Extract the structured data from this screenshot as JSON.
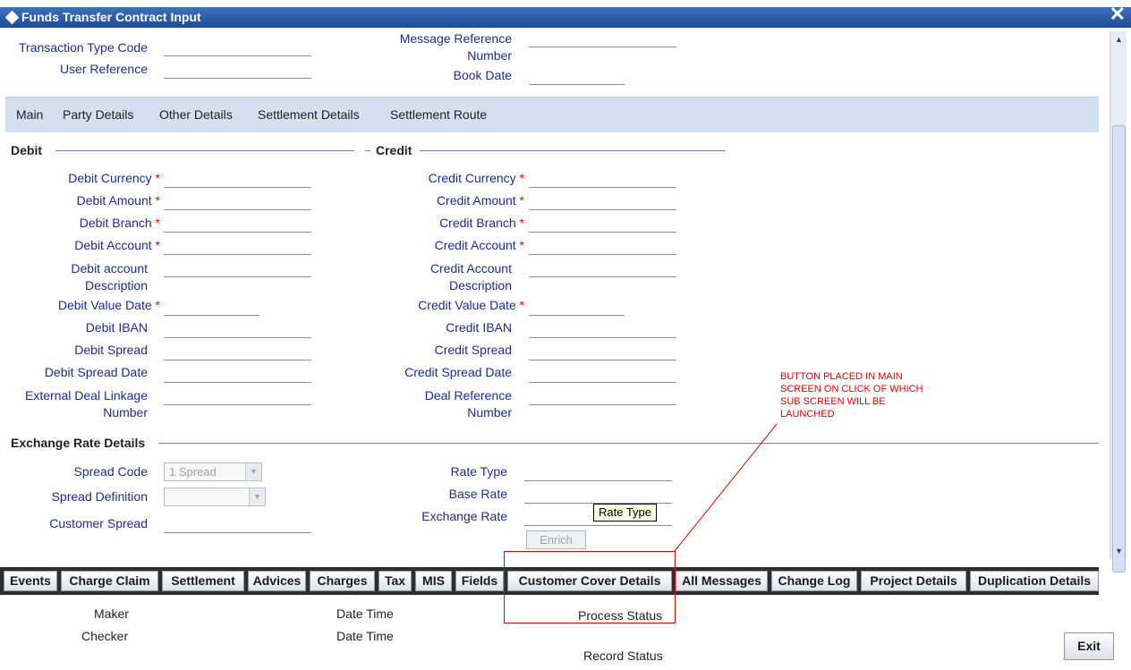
{
  "window": {
    "title": "Funds Transfer Contract Input",
    "close": "✕"
  },
  "header": {
    "transaction_type_code": "Transaction Type Code",
    "user_reference": "User Reference",
    "message_reference_1": "Message Reference",
    "message_reference_2": "Number",
    "book_date": "Book Date"
  },
  "tabs": [
    "Main",
    "Party Details",
    "Other Details",
    "Settlement Details",
    "Settlement Route"
  ],
  "debit": {
    "section": "Debit",
    "currency": "Debit Currency",
    "amount": "Debit Amount",
    "branch": "Debit Branch",
    "account": "Debit Account",
    "acc_desc_1": "Debit account",
    "acc_desc_2": "Description",
    "value_date": "Debit Value Date",
    "iban": "Debit IBAN",
    "spread": "Debit Spread",
    "spread_date": "Debit Spread Date",
    "ext_deal_1": "External Deal Linkage",
    "ext_deal_2": "Number"
  },
  "credit": {
    "section": "Credit",
    "currency": "Credit Currency",
    "amount": "Credit Amount",
    "branch": "Credit Branch",
    "account": "Credit Account",
    "acc_desc_1": "Credit Account",
    "acc_desc_2": "Description",
    "value_date": "Credit Value Date",
    "iban": "Credit IBAN",
    "spread": "Credit Spread",
    "spread_date": "Credit Spread Date",
    "deal_ref_1": "Deal Reference",
    "deal_ref_2": "Number"
  },
  "required_mark": "*",
  "exchange": {
    "section": "Exchange Rate Details",
    "spread_code": "Spread Code",
    "spread_code_value": "1 Spread",
    "spread_definition": "Spread Definition",
    "customer_spread": "Customer Spread",
    "rate_type": "Rate Type",
    "base_rate": "Base Rate",
    "exchange_rate": "Exchange Rate",
    "enrich": "Enrich",
    "tooltip": "Rate Type"
  },
  "annotation": [
    "BUTTON PLACED IN MAIN",
    "SCREEN ON CLICK OF WHICH",
    "SUB SCREEN WILL BE",
    "LAUNCHED"
  ],
  "buttons": [
    "Events",
    "Charge Claim",
    "Settlement",
    "Advices",
    "Charges",
    "Tax",
    "MIS",
    "Fields",
    "Customer Cover Details",
    "All Messages",
    "Change Log",
    "Project Details",
    "Duplication Details"
  ],
  "footer": {
    "maker": "Maker",
    "checker": "Checker",
    "date_time_1": "Date Time",
    "date_time_2": "Date Time",
    "process_status": "Process Status",
    "record_status": "Record Status",
    "exit": "Exit"
  },
  "colors": {
    "titlebar": "#2a5aa8",
    "label": "#1c2c8c",
    "required": "#e00000",
    "tabbar": "#d4dff0",
    "annotation": "#e00000"
  }
}
